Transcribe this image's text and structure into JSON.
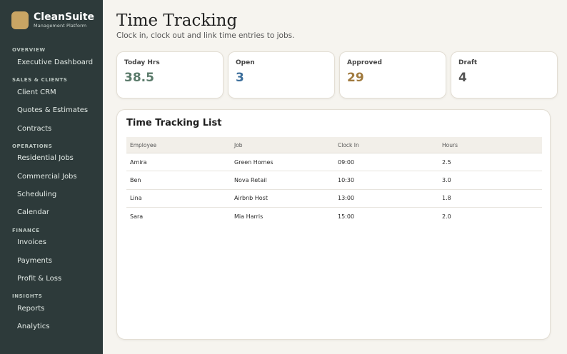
{
  "brand": {
    "name": "CleanSuite",
    "subtitle": "Management Platform"
  },
  "sidebar": {
    "sections": [
      {
        "label": "OVERVIEW",
        "items": [
          "Executive Dashboard"
        ]
      },
      {
        "label": "SALES & CLIENTS",
        "items": [
          "Client CRM",
          "Quotes & Estimates",
          "Contracts"
        ]
      },
      {
        "label": "OPERATIONS",
        "items": [
          "Residential Jobs",
          "Commercial Jobs",
          "Scheduling",
          "Calendar"
        ]
      },
      {
        "label": "FINANCE",
        "items": [
          "Invoices",
          "Payments",
          "Profit & Loss"
        ]
      },
      {
        "label": "INSIGHTS",
        "items": [
          "Reports",
          "Analytics"
        ]
      }
    ]
  },
  "header": {
    "title": "Time Tracking",
    "subtitle": "Clock in, clock out and link time entries to jobs."
  },
  "stats": [
    {
      "label": "Today Hrs",
      "value": "38.5",
      "color": "#5b7b6b"
    },
    {
      "label": "Open",
      "value": "3",
      "color": "#3d6f9c"
    },
    {
      "label": "Approved",
      "value": "29",
      "color": "#a07a3e"
    },
    {
      "label": "Draft",
      "value": "4",
      "color": "#555555"
    }
  ],
  "table": {
    "title": "Time Tracking List",
    "columns": [
      "Employee",
      "Job",
      "Clock In",
      "Hours"
    ],
    "rows": [
      [
        "Amira",
        "Green Homes",
        "09:00",
        "2.5"
      ],
      [
        "Ben",
        "Nova Retail",
        "10:30",
        "3.0"
      ],
      [
        "Lina",
        "Airbnb Host",
        "13:00",
        "1.8"
      ],
      [
        "Sara",
        "Mia Harris",
        "15:00",
        "2.0"
      ]
    ]
  },
  "colors": {
    "sidebar_bg": "#2d3a3a",
    "brand_accent": "#c9a564",
    "page_bg": "#f6f4ef"
  }
}
